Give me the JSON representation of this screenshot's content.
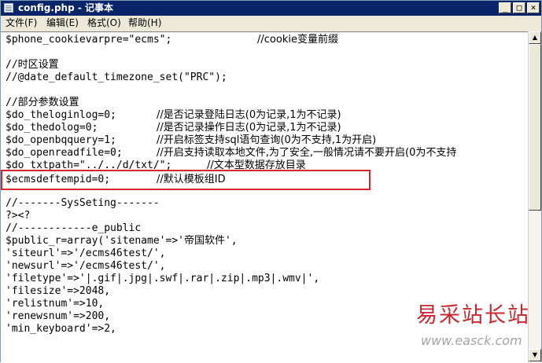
{
  "window": {
    "title": "config.php - 记事本",
    "minimize_glyph": "_",
    "maximize_glyph": "□",
    "close_glyph": "×"
  },
  "menu": {
    "items": [
      {
        "label": "文件(F)"
      },
      {
        "label": "编辑(E)"
      },
      {
        "label": "格式(O)"
      },
      {
        "label": "帮助(H)"
      }
    ]
  },
  "editor": {
    "lines": [
      {
        "code": "$phone_cookievarpre=\"ecms\";",
        "comment": "//cookie变量前缀"
      },
      {
        "code": "",
        "comment": ""
      },
      {
        "code": "//时区设置",
        "comment": ""
      },
      {
        "code": "//@date_default_timezone_set(\"PRC\");",
        "comment": ""
      },
      {
        "code": "",
        "comment": ""
      },
      {
        "code": "//部分参数设置",
        "comment": ""
      },
      {
        "code": "$do_theloginlog=0;",
        "comment": "//是否记录登陆日志(0为记录,1为不记录)"
      },
      {
        "code": "$do_thedolog=0;",
        "comment": "//是否记录操作日志(0为记录,1为不记录)"
      },
      {
        "code": "$do_openbqquery=1;",
        "comment": "//开启标签支持sql语句查询(0为不支持,1为开启)"
      },
      {
        "code": "$do_openreadfile=0;",
        "comment": "//开启支持读取本地文件,为了安全,一般情况请不要开启(0为不支持"
      },
      {
        "code": "$do_txtpath=\"../../d/txt/\";",
        "comment": "//文本型数据存放目录"
      },
      {
        "code": "$ecmsdeftempid=0;",
        "comment": "//默认模板组ID"
      },
      {
        "code": "",
        "comment": ""
      },
      {
        "code": "//-------SysSeting-------",
        "comment": ""
      },
      {
        "code": "?><?",
        "comment": ""
      },
      {
        "code": "//------------e_public",
        "comment": ""
      },
      {
        "code": "$public_r=array('sitename'=>'帝国软件',",
        "comment": ""
      },
      {
        "code": "'siteurl'=>'/ecms46test/',",
        "comment": ""
      },
      {
        "code": "'newsurl'=>'/ecms46test/',",
        "comment": ""
      },
      {
        "code": "'filetype'=>'|.gif|.jpg|.swf|.rar|.zip|.mp3|.wmv|',",
        "comment": ""
      },
      {
        "code": "'filesize'=>2048,",
        "comment": ""
      },
      {
        "code": "'relistnum'=>10,",
        "comment": ""
      },
      {
        "code": "'renewsnum'=>200,",
        "comment": ""
      },
      {
        "code": "'min_keyboard'=>2,",
        "comment": ""
      }
    ]
  },
  "watermark": {
    "site_name": "易采站长站",
    "url": "www.easck.com"
  }
}
